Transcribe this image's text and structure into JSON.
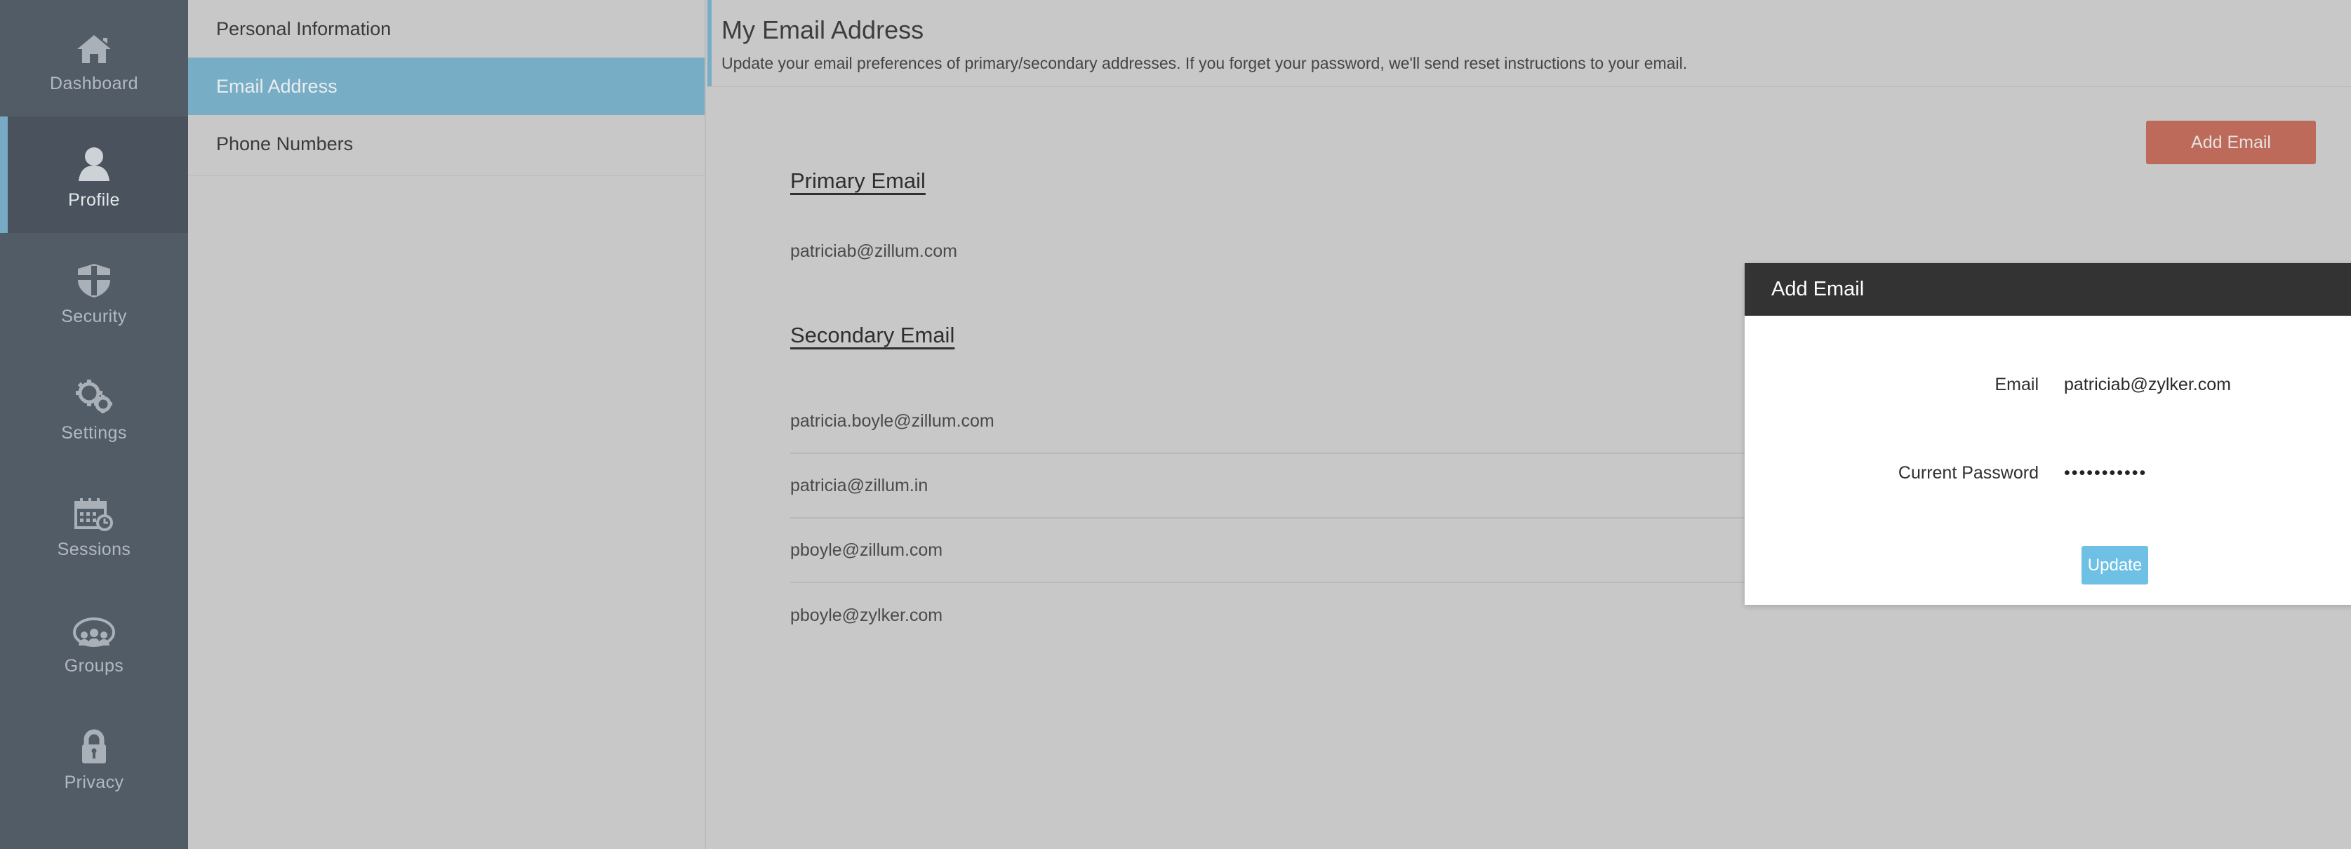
{
  "sidebar": {
    "items": [
      {
        "label": "Dashboard",
        "icon": "home-icon",
        "active": false
      },
      {
        "label": "Profile",
        "icon": "user-icon",
        "active": true
      },
      {
        "label": "Security",
        "icon": "shield-icon",
        "active": false
      },
      {
        "label": "Settings",
        "icon": "gears-icon",
        "active": false
      },
      {
        "label": "Sessions",
        "icon": "calendar-clock-icon",
        "active": false
      },
      {
        "label": "Groups",
        "icon": "people-group-icon",
        "active": false
      },
      {
        "label": "Privacy",
        "icon": "lock-icon",
        "active": false
      }
    ]
  },
  "secondary_nav": {
    "items": [
      {
        "label": "Personal Information",
        "active": false
      },
      {
        "label": "Email Address",
        "active": true
      },
      {
        "label": "Phone Numbers",
        "active": false
      }
    ]
  },
  "header": {
    "title": "My Email Address",
    "subtitle": "Update your email preferences of primary/secondary addresses. If you forget your password, we'll send reset instructions to your email."
  },
  "toolbar": {
    "add_email_label": "Add Email"
  },
  "primary_email": {
    "heading": "Primary Email",
    "address": "patriciab@zillum.com",
    "edit_icon": "pencil-icon"
  },
  "secondary_email": {
    "heading": "Secondary Email",
    "addresses": [
      "patricia.boyle@zillum.com",
      "patricia@zillum.in",
      "pboyle@zillum.com",
      "pboyle@zylker.com"
    ]
  },
  "modal": {
    "title": "Add Email",
    "close_label": "×",
    "close_icon": "close-icon",
    "email_label": "Email",
    "email_value": "patriciab@zylker.com",
    "password_label": "Current Password",
    "password_value": "•••••••••••",
    "lock_icon": "lock-icon",
    "update_label": "Update"
  },
  "colors": {
    "sidebar_bg": "#525c67",
    "sidebar_active_bg": "#4a535d",
    "accent_blue": "#78adc6",
    "page_bg": "#c8c8c8",
    "add_email_red": "#bd6a5a",
    "update_blue": "#6ec1e4",
    "modal_header": "#333333"
  }
}
